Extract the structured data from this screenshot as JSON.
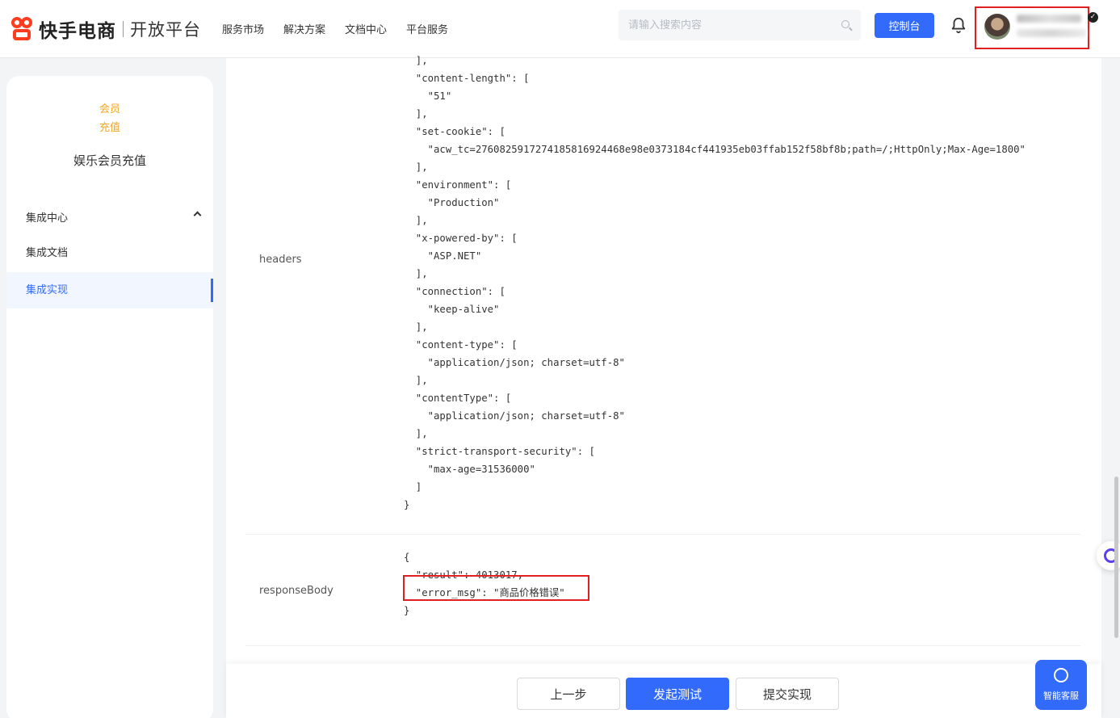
{
  "header": {
    "brand": "快手电商",
    "platform": "开放平台",
    "nav": [
      "服务市场",
      "解决方案",
      "文档中心",
      "平台服务"
    ],
    "search_placeholder": "请输入搜索内容",
    "console_label": "控制台"
  },
  "sidebar": {
    "product_logo_line1": "会员",
    "product_logo_line2": "充值",
    "product_name": "娱乐会员充值",
    "group_label": "集成中心",
    "items": [
      {
        "label": "集成文档",
        "active": false
      },
      {
        "label": "集成实现",
        "active": true
      }
    ]
  },
  "main": {
    "headers_label": "headers",
    "headers_code": "  ],\n  \"content-length\": [\n    \"51\"\n  ],\n  \"set-cookie\": [\n    \"acw_tc=2760825917274185816924468e98e0373184cf441935eb03ffab152f58bf8b;path=/;HttpOnly;Max-Age=1800\"\n  ],\n  \"environment\": [\n    \"Production\"\n  ],\n  \"x-powered-by\": [\n    \"ASP.NET\"\n  ],\n  \"connection\": [\n    \"keep-alive\"\n  ],\n  \"content-type\": [\n    \"application/json; charset=utf-8\"\n  ],\n  \"contentType\": [\n    \"application/json; charset=utf-8\"\n  ],\n  \"strict-transport-security\": [\n    \"max-age=31536000\"\n  ]\n}",
    "response_label": "responseBody",
    "response_code": "{\n  \"result\": 4013017,\n  \"error_msg\": \"商品价格错误\"\n}"
  },
  "footer": {
    "prev_label": "上一步",
    "test_label": "发起测试",
    "submit_label": "提交实现"
  },
  "support_label": "智能客服",
  "colors": {
    "primary": "#326bfb",
    "brand": "#fe3c1f",
    "product_logo": "#f5a623",
    "highlight": "#e02020"
  }
}
